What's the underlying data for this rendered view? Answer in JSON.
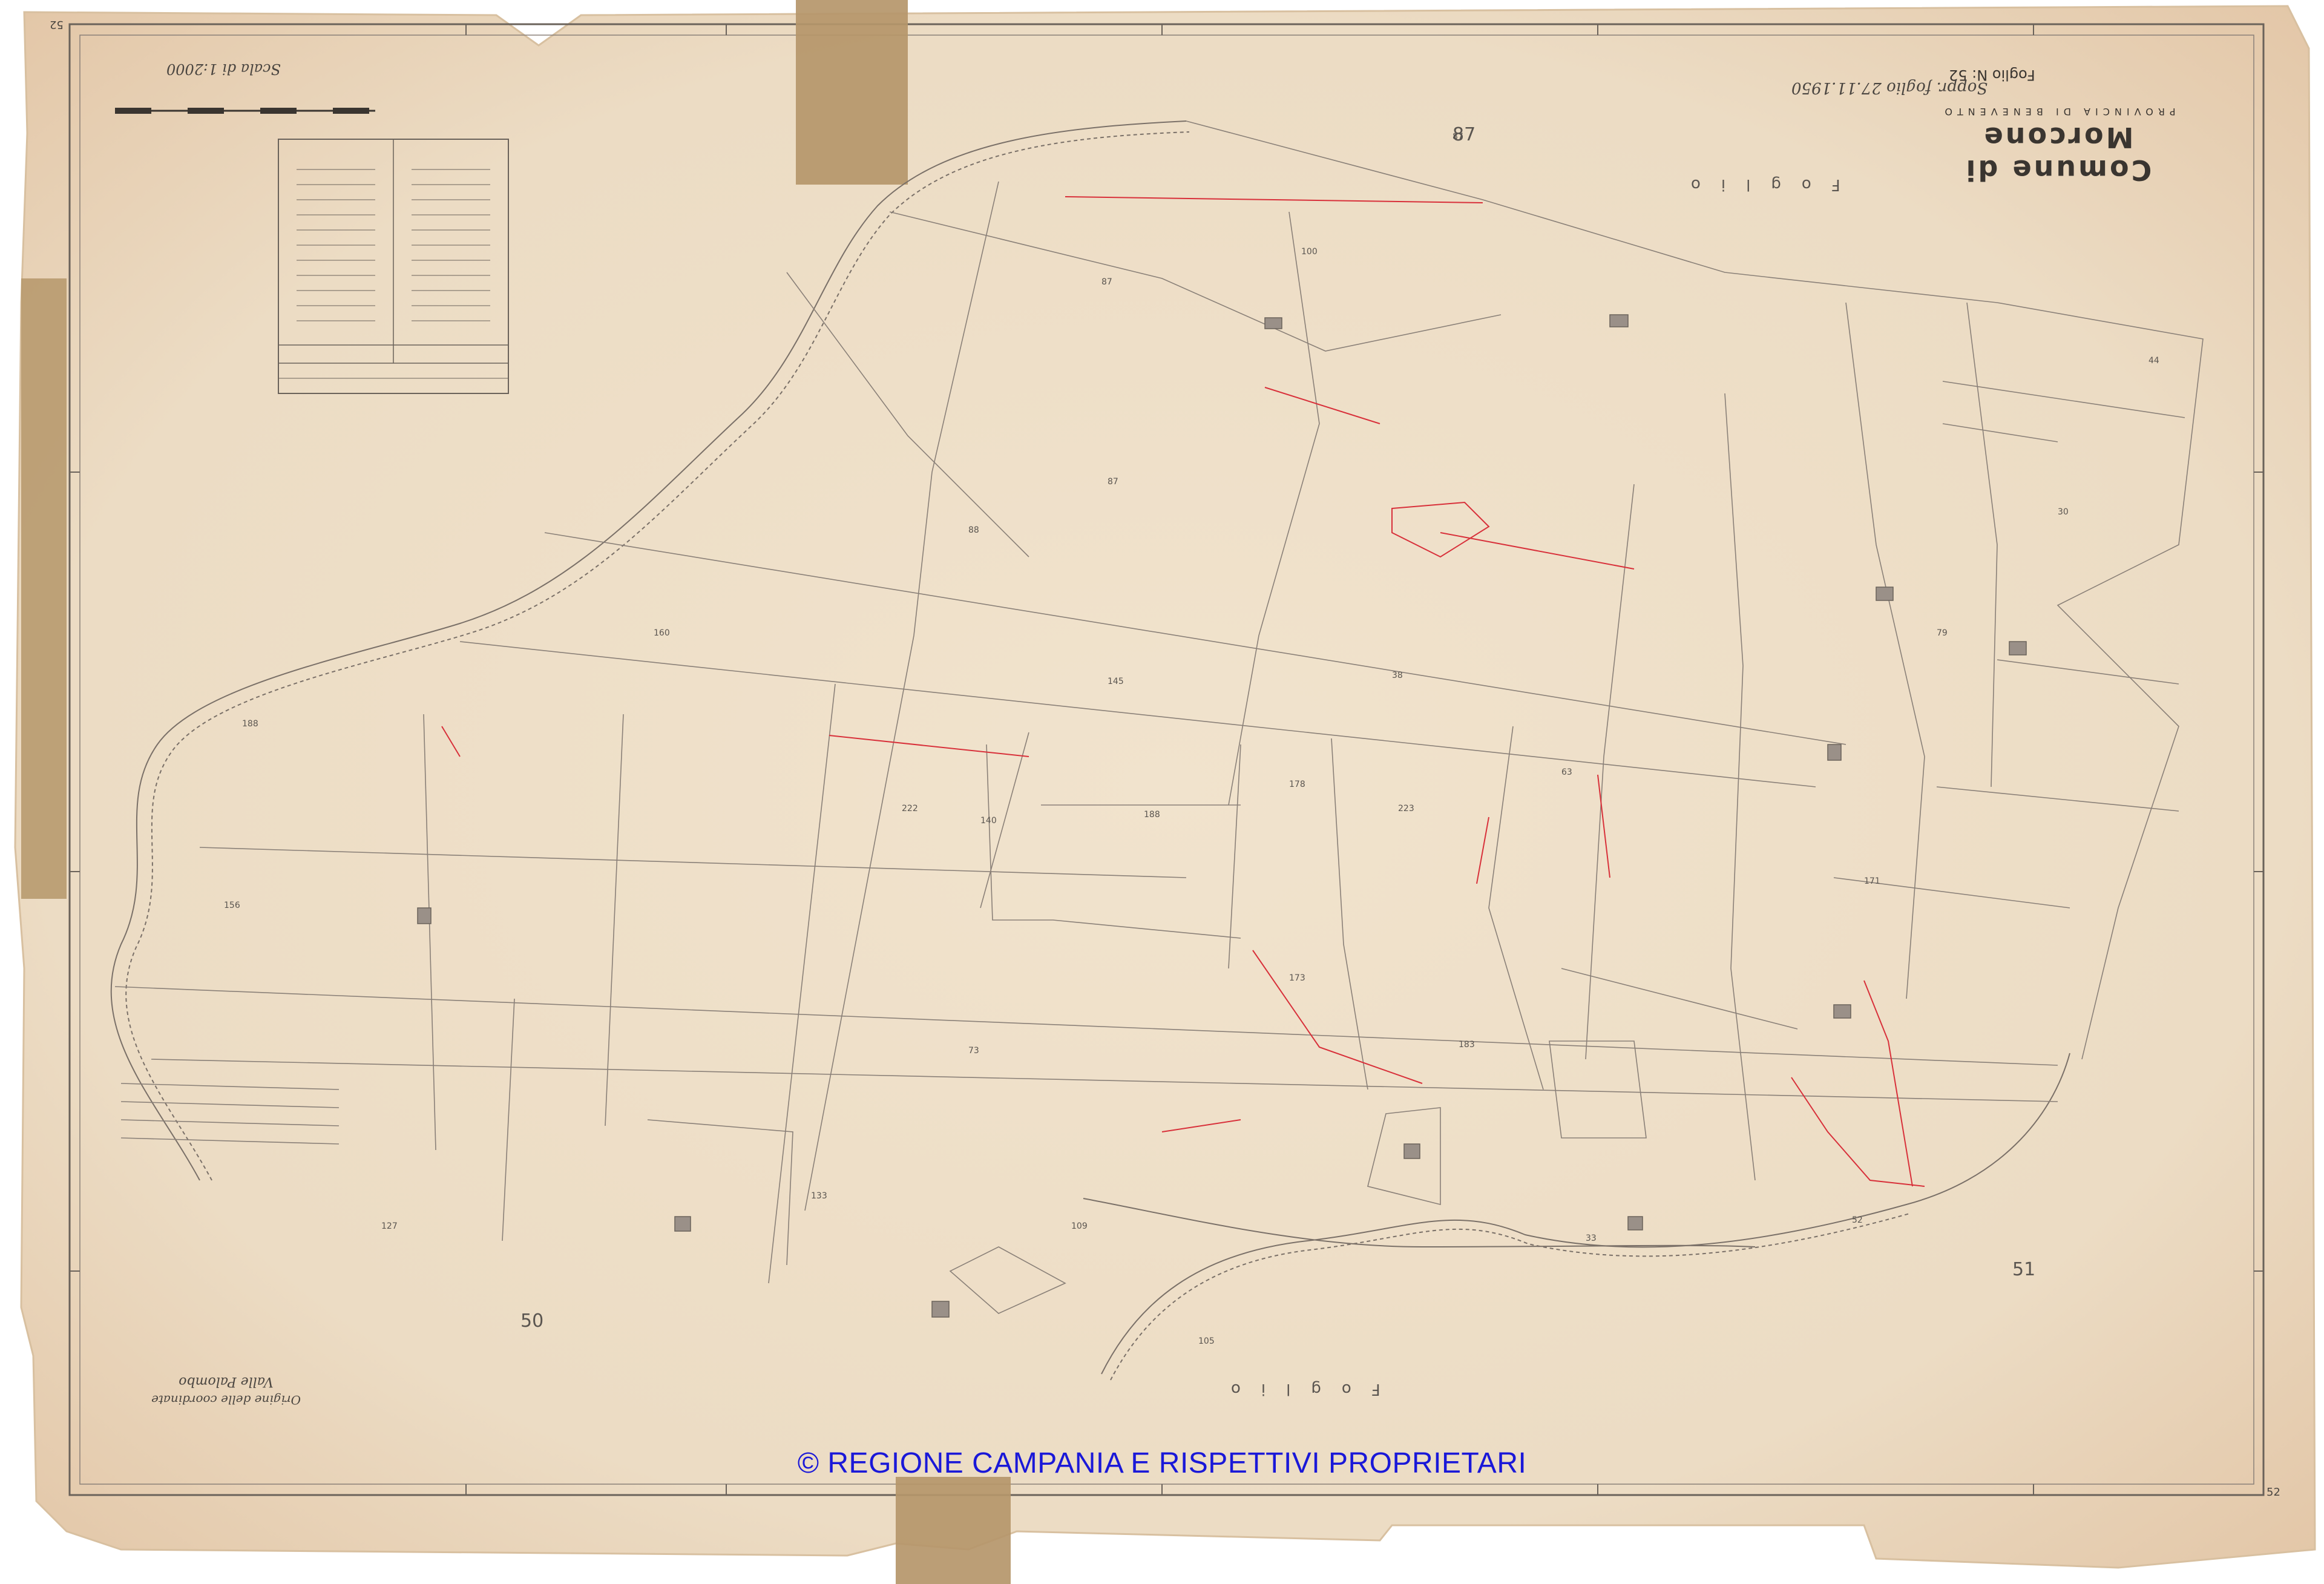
{
  "watermark": "© REGIONE CAMPANIA E RISPETTIVI PROPRIETARI",
  "title": {
    "comune": "Comune di Morcone",
    "provincia": "PROVINCIA DI BENEVENTO",
    "foglio": "Foglio N: 52"
  },
  "scale_text": "Scala di 1:2000",
  "origin": {
    "label": "Origine delle coordinate",
    "place": "Valle Palombo"
  },
  "sheet_words": {
    "top": "Foglio",
    "bottom": "Foglio"
  },
  "annotation": "Soppr. foglio 27.11.1950",
  "corner_numbers": [
    "52",
    "52"
  ],
  "sheet_refs": {
    "top": "87",
    "bottom": "50",
    "right": "51"
  },
  "colors": {
    "paper": "#efe0c8",
    "paper_edge": "#e5caa8",
    "ink": "#7a7068",
    "red_ink": "#d8303a",
    "tape": "#b89a68",
    "watermark": "#1a18d8"
  }
}
